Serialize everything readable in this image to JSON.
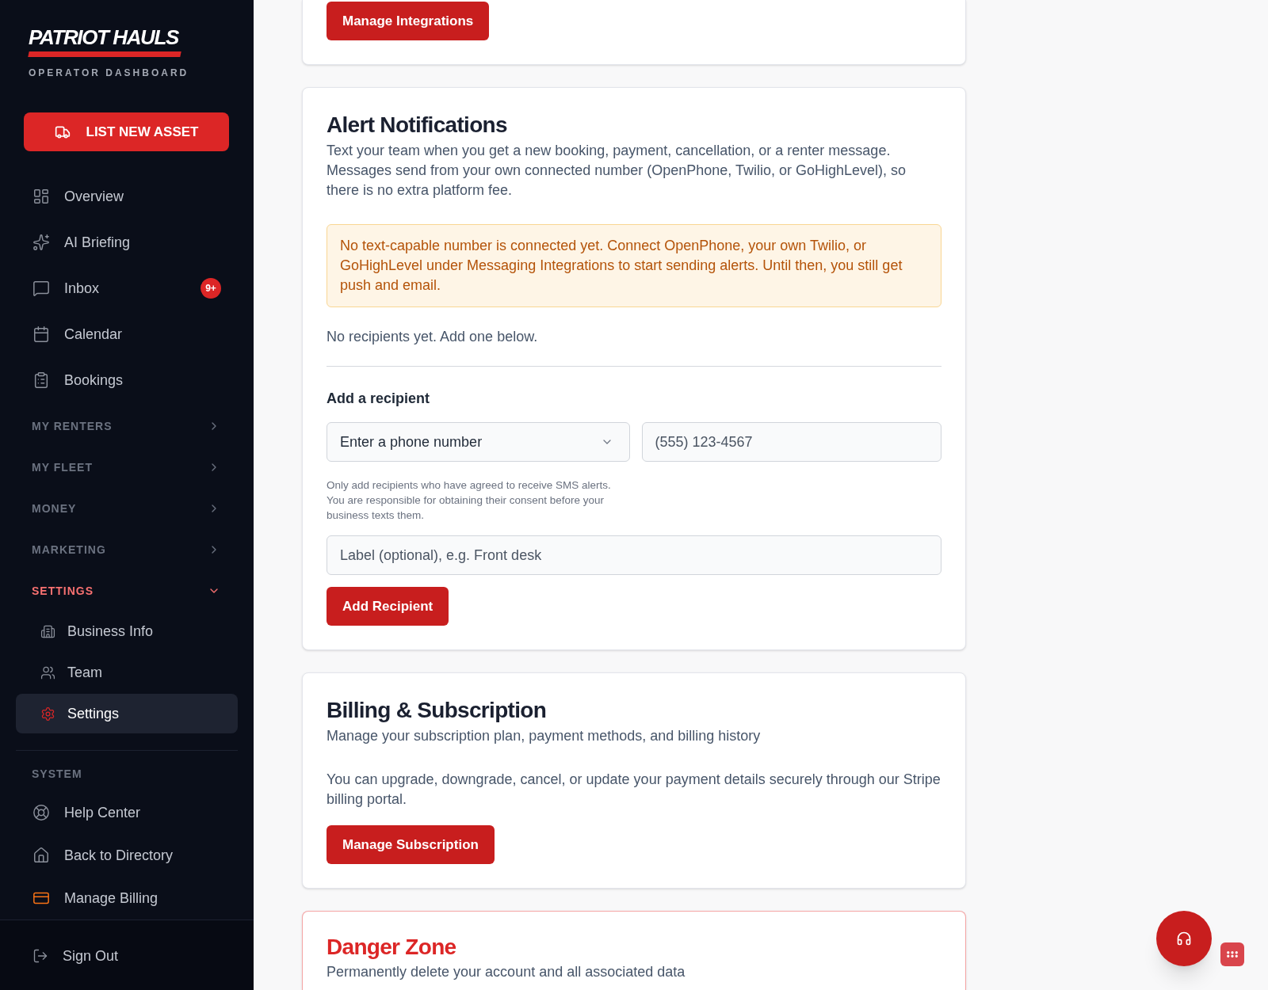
{
  "sidebar": {
    "brand": {
      "name": "PATRIOT HAULS",
      "tagline": "OPERATOR DASHBOARD"
    },
    "cta_button": {
      "label": "LIST NEW ASSET"
    },
    "main_items": [
      {
        "label": "Overview",
        "selected": false
      },
      {
        "label": "AI Briefing",
        "selected": false
      },
      {
        "label": "Inbox",
        "selected": false,
        "badge": "9+"
      },
      {
        "label": "Calendar",
        "selected": false
      },
      {
        "label": "Bookings",
        "selected": false
      }
    ],
    "sections": [
      {
        "label": "MY RENTERS",
        "expanded": false
      },
      {
        "label": "MY FLEET",
        "expanded": false
      },
      {
        "label": "MONEY",
        "expanded": false
      },
      {
        "label": "MARKETING",
        "expanded": false
      },
      {
        "label": "SETTINGS",
        "expanded": true,
        "children": [
          {
            "label": "Business Info",
            "selected": false
          },
          {
            "label": "Team",
            "selected": false
          },
          {
            "label": "Settings",
            "selected": true
          }
        ]
      }
    ],
    "system": {
      "heading": "SYSTEM",
      "items": [
        {
          "label": "Help Center",
          "selected": false
        },
        {
          "label": "Back to Directory",
          "selected": false
        },
        {
          "label": "Manage Billing",
          "selected": false
        }
      ]
    },
    "sign_out": {
      "label": "Sign Out"
    }
  },
  "main": {
    "integrations_card": {
      "button": "Manage Integrations"
    },
    "alerts_card": {
      "title": "Alert Notifications",
      "description": "Text your team when you get a new booking, payment, cancellation, or a renter message. Messages send from your own connected number (OpenPhone, Twilio, or GoHighLevel), so there is no extra platform fee.",
      "warning": "No text-capable number is connected yet. Connect OpenPhone, your own Twilio, or GoHighLevel under Messaging Integrations to start sending alerts. Until then, you still get push and email.",
      "empty_text": "No recipients yet. Add one below.",
      "form": {
        "heading": "Add a recipient",
        "type_select": {
          "value": "Enter a phone number"
        },
        "phone_field": {
          "placeholder": "(555) 123-4567"
        },
        "consent_note": "Only add recipients who have agreed to receive SMS alerts. You are responsible for obtaining their consent before your business texts them.",
        "label_field": {
          "placeholder": "Label (optional), e.g. Front desk"
        },
        "submit_button": "Add Recipient"
      }
    },
    "billing_card": {
      "title": "Billing & Subscription",
      "subtitle": "Manage your subscription plan, payment methods, and billing history",
      "body": "You can upgrade, downgrade, cancel, or update your payment details securely through our Stripe billing portal.",
      "button": "Manage Subscription"
    },
    "danger_card": {
      "title": "Danger Zone",
      "subtitle": "Permanently delete your account and all associated data"
    }
  }
}
